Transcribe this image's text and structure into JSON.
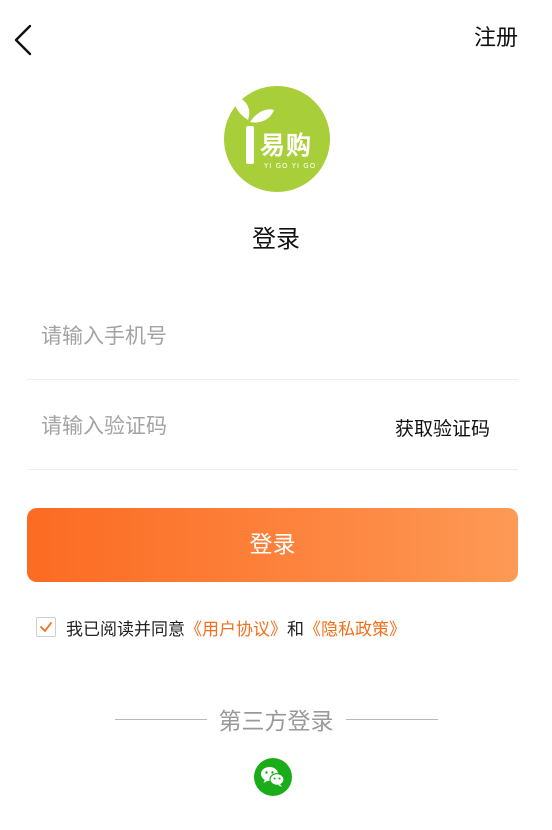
{
  "header": {
    "back_icon": "chevron-left-icon",
    "register_label": "注册"
  },
  "logo": {
    "text": "易购",
    "subtext": "YI GO YI GO",
    "color": "#a8cf3a"
  },
  "page_title": "登录",
  "form": {
    "phone_placeholder": "请输入手机号",
    "phone_value": "",
    "code_placeholder": "请输入验证码",
    "code_value": "",
    "get_code_label": "获取验证码"
  },
  "login_button_label": "登录",
  "agreement": {
    "checked": true,
    "prefix": "我已阅读并同意",
    "user_agreement": "《用户协议》",
    "connector": "和",
    "privacy_policy": "《隐私政策》",
    "link_color": "#f36f1e"
  },
  "third_party": {
    "label": "第三方登录",
    "wechat_icon": "wechat-icon",
    "wechat_color": "#1aad19"
  },
  "accent_color": "#fc6b22"
}
